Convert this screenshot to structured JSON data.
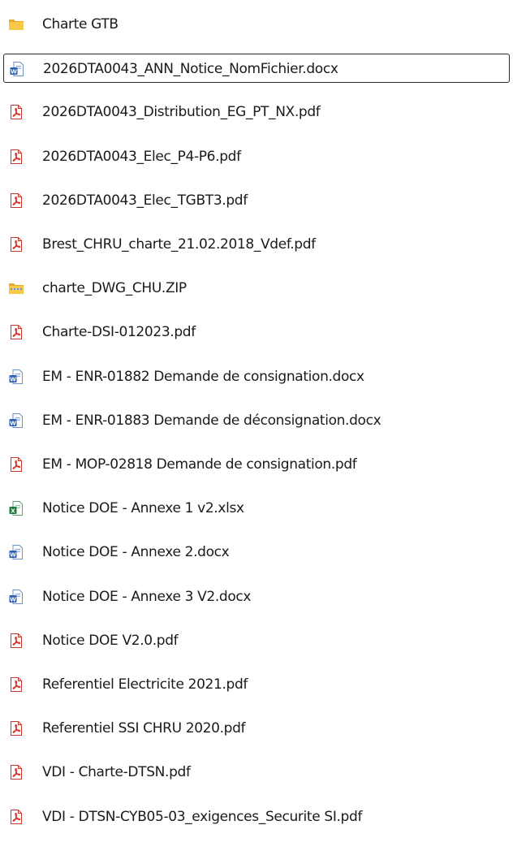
{
  "file_list": {
    "items": [
      {
        "name": "Charte GTB",
        "icon": "folder-icon",
        "selected": false
      },
      {
        "name": "2026DTA0043_ANN_Notice_NomFichier.docx",
        "icon": "word-doc-icon",
        "selected": true
      },
      {
        "name": "2026DTA0043_Distribution_EG_PT_NX.pdf",
        "icon": "pdf-icon",
        "selected": false
      },
      {
        "name": "2026DTA0043_Elec_P4-P6.pdf",
        "icon": "pdf-icon",
        "selected": false
      },
      {
        "name": "2026DTA0043_Elec_TGBT3.pdf",
        "icon": "pdf-icon",
        "selected": false
      },
      {
        "name": "Brest_CHRU_charte_21.02.2018_Vdef.pdf",
        "icon": "pdf-icon",
        "selected": false
      },
      {
        "name": "charte_DWG_CHU.ZIP",
        "icon": "zip-folder-icon",
        "selected": false
      },
      {
        "name": "Charte-DSI-012023.pdf",
        "icon": "pdf-icon",
        "selected": false
      },
      {
        "name": "EM - ENR-01882 Demande de consignation.docx",
        "icon": "word-doc-icon",
        "selected": false
      },
      {
        "name": "EM - ENR-01883 Demande de déconsignation.docx",
        "icon": "word-doc-icon",
        "selected": false
      },
      {
        "name": "EM - MOP-02818 Demande de consignation.pdf",
        "icon": "pdf-icon",
        "selected": false
      },
      {
        "name": "Notice DOE - Annexe 1 v2.xlsx",
        "icon": "excel-sheet-icon",
        "selected": false
      },
      {
        "name": "Notice DOE - Annexe 2.docx",
        "icon": "word-doc-icon",
        "selected": false
      },
      {
        "name": "Notice DOE - Annexe 3 V2.docx",
        "icon": "word-doc-icon",
        "selected": false
      },
      {
        "name": "Notice DOE V2.0.pdf",
        "icon": "pdf-icon",
        "selected": false
      },
      {
        "name": "Referentiel Electricite 2021.pdf",
        "icon": "pdf-icon",
        "selected": false
      },
      {
        "name": "Referentiel SSI CHRU 2020.pdf",
        "icon": "pdf-icon",
        "selected": false
      },
      {
        "name": "VDI - Charte-DTSN.pdf",
        "icon": "pdf-icon",
        "selected": false
      },
      {
        "name": "VDI - DTSN-CYB05-03_exigences_Securite SI.pdf",
        "icon": "pdf-icon",
        "selected": false
      }
    ]
  },
  "colors": {
    "text": "#1a1a1a",
    "selection_border": "#2b2b2b",
    "folder_yellow": "#f5c242",
    "pdf_red": "#d93025",
    "word_blue": "#2b5fb4",
    "excel_green": "#1e7a3c"
  }
}
